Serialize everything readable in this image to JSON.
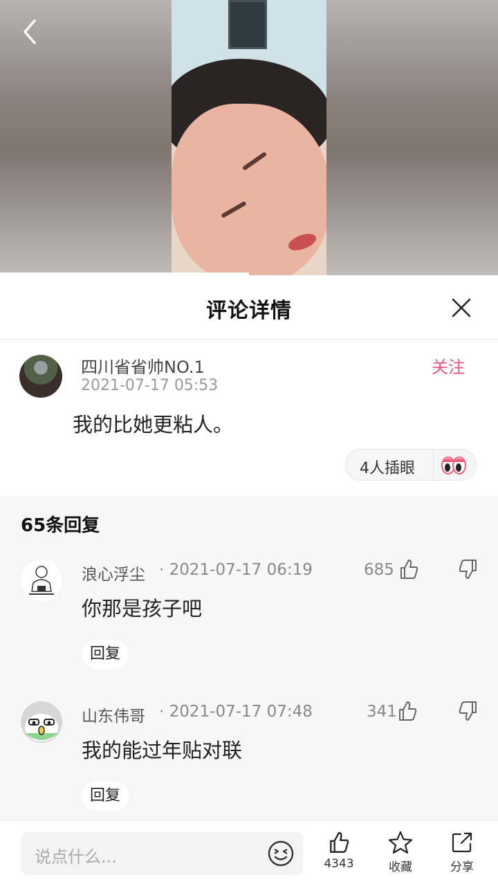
{
  "sheet": {
    "title": "评论详情"
  },
  "main_comment": {
    "author": "四川省省帅NO.1",
    "time": "2021-07-17 05:53",
    "follow_label": "关注",
    "text": "我的比她更粘人。",
    "poke_label": "4人插眼"
  },
  "replies": {
    "count_label": "65条回复",
    "items": [
      {
        "author": "浪心浮尘",
        "time": "· 2021-07-17 06:19",
        "likes": "685",
        "text": "你那是孩子吧",
        "reply_label": "回复"
      },
      {
        "author": "山东伟哥",
        "time": "· 2021-07-17 07:48",
        "likes": "341",
        "text": "我的能过年贴对联",
        "reply_label": "回复"
      }
    ]
  },
  "bottom_bar": {
    "input_placeholder": "说点什么...",
    "like_count": "4343",
    "favorite_label": "收藏",
    "share_label": "分享"
  },
  "colors": {
    "accent": "#f0547a",
    "text_primary": "#111111",
    "text_secondary": "#888888",
    "replies_bg": "#f7f7f7"
  },
  "icons": [
    "back-arrow-icon",
    "close-icon",
    "eyes-icon",
    "thumb-up-icon",
    "thumb-down-icon",
    "emoji-icon",
    "star-icon",
    "share-icon"
  ]
}
